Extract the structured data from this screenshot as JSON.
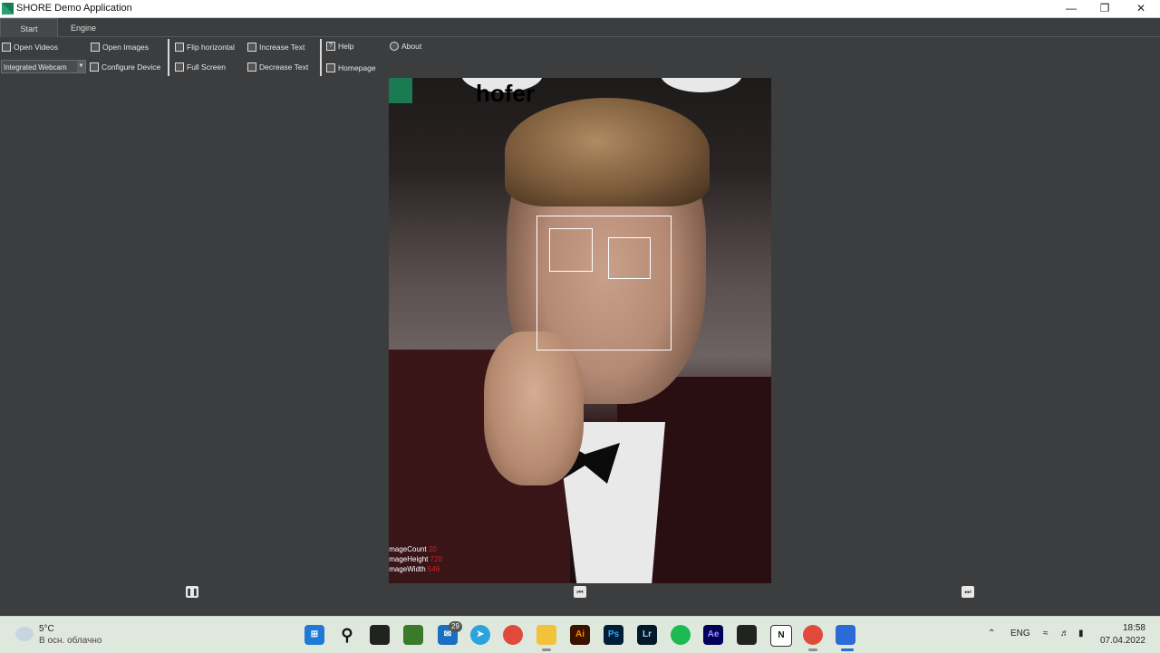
{
  "window": {
    "title": "SHORE Demo Application"
  },
  "tabs": [
    "Start",
    "Engine"
  ],
  "ribbon": {
    "open_videos": "Open Videos",
    "open_images": "Open Images",
    "flip_horizontal": "Flip horizontal",
    "increase_text": "Increase Text",
    "help": "Help",
    "about": "About",
    "device_select": "Integrated Webcam",
    "configure_device": "Configure Device",
    "full_screen": "Full Screen",
    "decrease_text": "Decrease Text",
    "homepage": "Homepage"
  },
  "image": {
    "logo_text": "hofer",
    "stats": [
      {
        "label": "ImageCount",
        "value": "20"
      },
      {
        "label": "ImageHeight",
        "value": "720"
      },
      {
        "label": "ImageWidth",
        "value": "546"
      }
    ]
  },
  "taskbar": {
    "weather_temp": "5°C",
    "weather_desc": "В осн. облачно",
    "mail_badge": "29",
    "language": "ENG",
    "time": "18:58",
    "date": "07.04.2022"
  },
  "colors": {
    "accent_green": "#1a7a52",
    "stat_value": "#d02020",
    "background": "#3b3d3f"
  }
}
